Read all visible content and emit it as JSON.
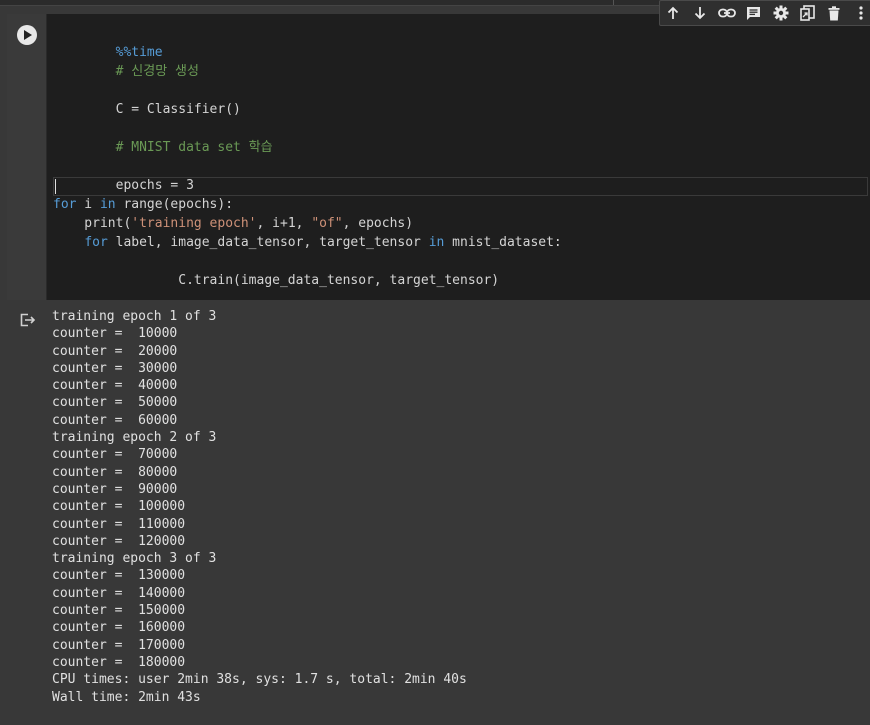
{
  "code": {
    "magic": "%%time",
    "comment1": "# 신경망 생성",
    "line_classifier": "C = Classifier()",
    "comment2": "# MNIST data set 학습",
    "line_epochs": "epochs = 3",
    "for1": {
      "kw_for": "for",
      "var": " i ",
      "kw_in": "in",
      "rest": " range(epochs):"
    },
    "print": {
      "prefix": "    print(",
      "str1": "'training epoch'",
      "mid": ", i+1, ",
      "str2": "\"of\"",
      "suffix": ", epochs)"
    },
    "for2": {
      "indent": "    ",
      "kw_for": "for",
      "vars": " label, image_data_tensor, target_tensor ",
      "kw_in": "in",
      "rest": " mnist_dataset:"
    },
    "train": "        C.train(image_data_tensor, target_tensor)"
  },
  "toolbar": {
    "icons": [
      "arrow-up-icon",
      "arrow-down-icon",
      "link-icon",
      "comment-icon",
      "settings-icon",
      "mirror-cell-icon",
      "delete-icon",
      "more-icon"
    ]
  },
  "output": {
    "lines": [
      "training epoch 1 of 3",
      "counter =  10000",
      "counter =  20000",
      "counter =  30000",
      "counter =  40000",
      "counter =  50000",
      "counter =  60000",
      "training epoch 2 of 3",
      "counter =  70000",
      "counter =  80000",
      "counter =  90000",
      "counter =  100000",
      "counter =  110000",
      "counter =  120000",
      "training epoch 3 of 3",
      "counter =  130000",
      "counter =  140000",
      "counter =  150000",
      "counter =  160000",
      "counter =  170000",
      "counter =  180000",
      "CPU times: user 2min 38s, sys: 1.7 s, total: 2min 40s",
      "Wall time: 2min 43s"
    ]
  }
}
